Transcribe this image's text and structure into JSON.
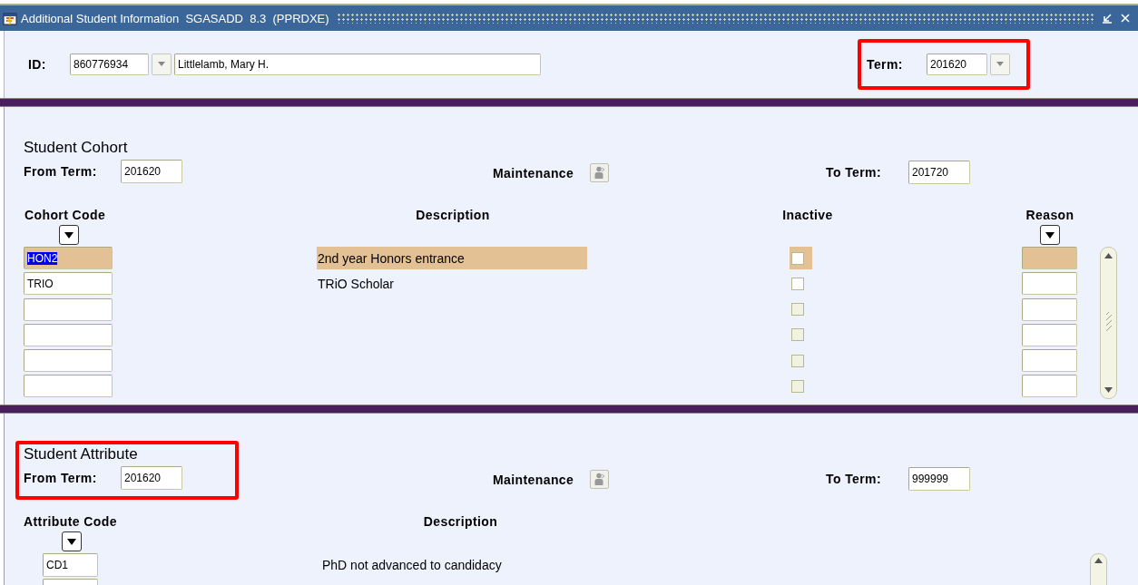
{
  "window": {
    "title": "Additional Student Information  SGASADD  8.3  (PPRDXE)"
  },
  "key_block": {
    "id_label": "ID:",
    "id": "860776934",
    "name": "Littlelamb, Mary H.",
    "term_label": "Term:",
    "term": "201620",
    "term_highlighted": true
  },
  "cohort": {
    "title": "Student Cohort",
    "from_label": "From Term:",
    "from_term": "201620",
    "maintenance_label": "Maintenance",
    "to_label": "To Term:",
    "to_term": "201720",
    "columns": [
      "Cohort Code",
      "Description",
      "Inactive",
      "Reason"
    ],
    "rows": [
      {
        "code": "HON2",
        "description": "2nd year Honors entrance",
        "inactive": false,
        "disabled": false,
        "selected": true
      },
      {
        "code": "TRIO",
        "description": "TRiO Scholar",
        "inactive": false,
        "disabled": false,
        "selected": false
      },
      {
        "inactive": false,
        "disabled": true,
        "selected": false
      },
      {
        "inactive": false,
        "disabled": true,
        "selected": false
      },
      {
        "inactive": false,
        "disabled": true,
        "selected": false
      },
      {
        "inactive": false,
        "disabled": true,
        "selected": false
      }
    ]
  },
  "attribute": {
    "title": "Student Attribute",
    "highlighted": true,
    "from_label": "From Term:",
    "from_term": "201620",
    "maintenance_label": "Maintenance",
    "to_label": "To Term:",
    "to_term": "999999",
    "columns": [
      "Attribute Code",
      "Description"
    ],
    "rows": [
      {
        "code": "CD1",
        "description": "PhD not advanced to candidacy",
        "selected": false
      },
      {
        "selected": false
      }
    ]
  }
}
